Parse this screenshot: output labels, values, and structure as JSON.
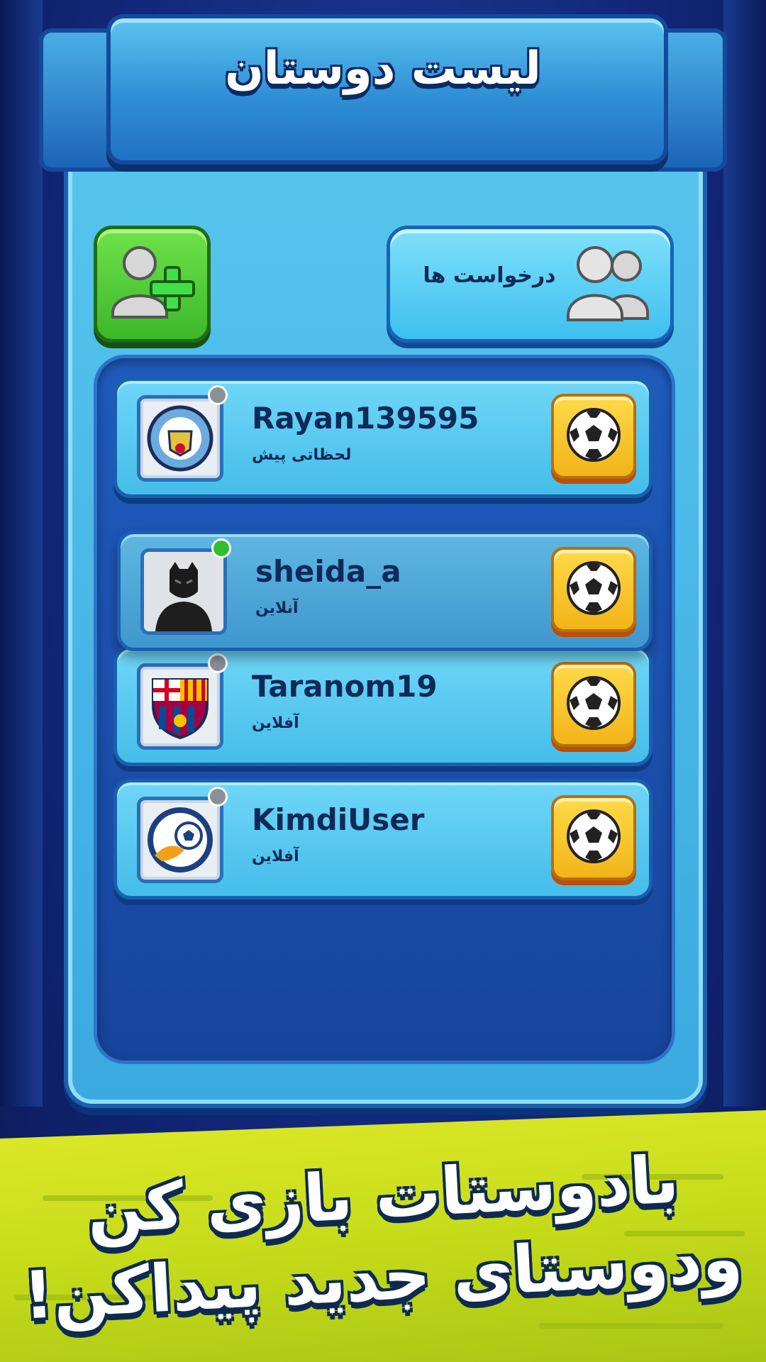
{
  "header": {
    "title": "لیست دوستان"
  },
  "buttons": {
    "add_friend_icon": "add-user-icon",
    "requests_label": "درخواست ها",
    "requests_icon": "users-icon"
  },
  "friends": [
    {
      "username": "Rayan139595",
      "status": "لحظاتی پیش",
      "avatar": "manchester-city-logo",
      "online": false
    },
    {
      "username": "sheida_a",
      "status": "آنلاین",
      "avatar": "black-panther-avatar",
      "online": true
    },
    {
      "username": "Taranom19",
      "status": "آفلاین",
      "avatar": "fc-barcelona-logo",
      "online": false
    },
    {
      "username": "KimdiUser",
      "status": "آفلاین",
      "avatar": "football-league-logo",
      "online": false
    }
  ],
  "colors": {
    "online": "#2fbf2a",
    "offline": "#8a8f98",
    "accent_yellow": "#f2b418",
    "panel_blue": "#3aa9e0"
  },
  "promo": {
    "line1": "بادوستات بازی کن",
    "line2": "ودوستای جدید پیداکن!"
  }
}
